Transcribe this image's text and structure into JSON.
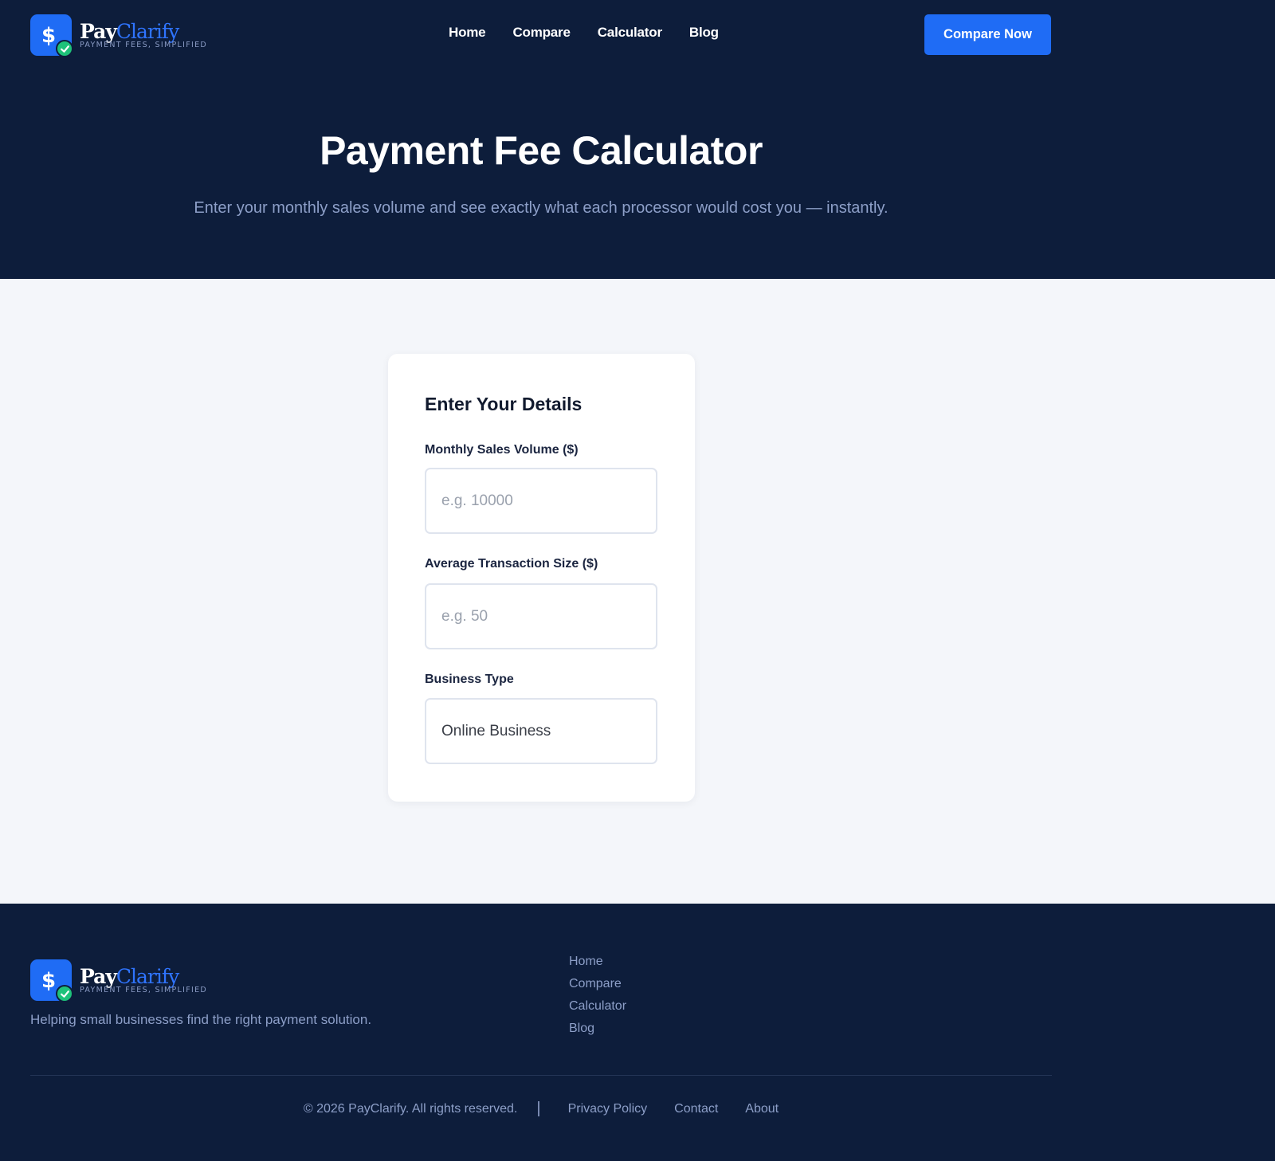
{
  "brand": {
    "name_part1": "Pay",
    "name_part2": "Clarify",
    "tagline": "PAYMENT FEES, SIMPLIFIED",
    "badge_symbol": "$",
    "colors": {
      "navy": "#0d1d3b",
      "accent": "#1f6cf5",
      "check": "#1ec27a"
    }
  },
  "nav": {
    "links": [
      "Home",
      "Compare",
      "Calculator",
      "Blog"
    ],
    "cta_label": "Compare Now"
  },
  "hero": {
    "title": "Payment Fee Calculator",
    "subtitle": "Enter your monthly sales volume and see exactly what each processor would cost you — instantly."
  },
  "form": {
    "title": "Enter Your Details",
    "monthly_sales": {
      "label": "Monthly Sales Volume ($)",
      "placeholder": "e.g. 10000"
    },
    "avg_transaction": {
      "label": "Average Transaction Size ($)",
      "placeholder": "e.g. 50"
    },
    "business_type": {
      "label": "Business Type",
      "selected": "Online Business"
    }
  },
  "footer": {
    "description": "Helping small businesses find the right payment solution.",
    "links": [
      "Home",
      "Compare",
      "Calculator",
      "Blog"
    ],
    "copyright": "© 2026 PayClarify. All rights reserved.",
    "separator": "|",
    "bottom_links": [
      "Privacy Policy",
      "Contact",
      "About"
    ]
  }
}
